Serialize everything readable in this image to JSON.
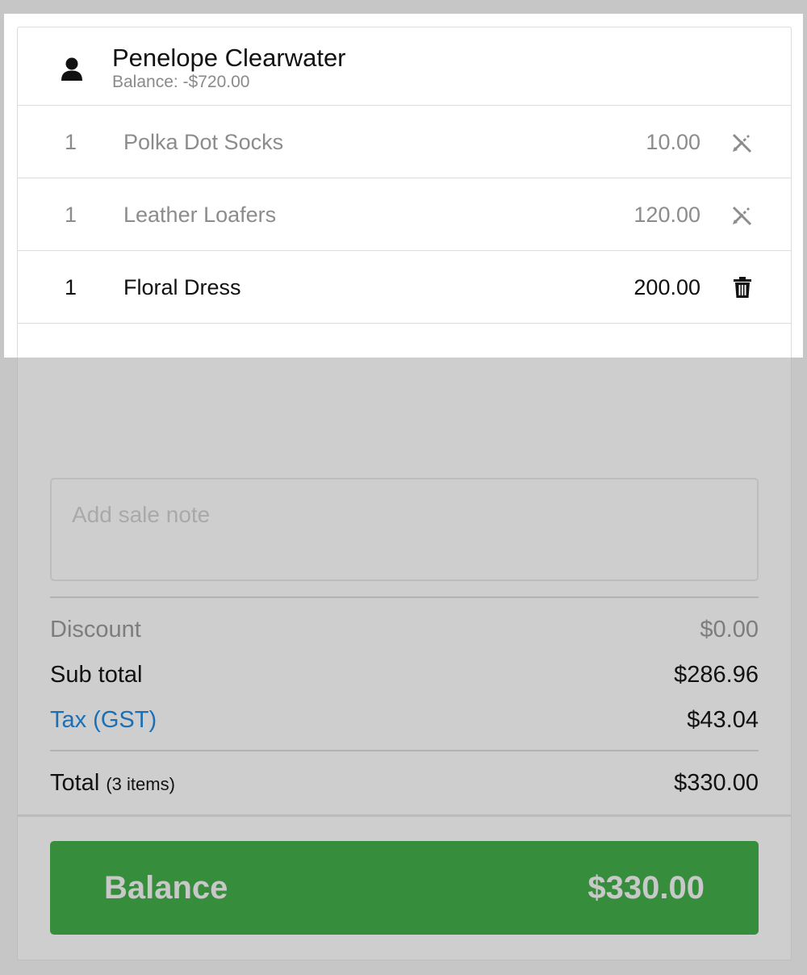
{
  "customer": {
    "name": "Penelope Clearwater",
    "balance_text": "Balance: -$720.00",
    "icon": "user-icon"
  },
  "line_items": [
    {
      "qty": "1",
      "name": "Polka Dot Socks",
      "price": "10.00",
      "action_icon": "pencil-disabled-icon",
      "state": "muted"
    },
    {
      "qty": "1",
      "name": "Leather Loafers",
      "price": "120.00",
      "action_icon": "pencil-disabled-icon",
      "state": "muted"
    },
    {
      "qty": "1",
      "name": "Floral Dress",
      "price": "200.00",
      "action_icon": "trash-icon",
      "state": "active"
    }
  ],
  "note": {
    "placeholder": "Add sale note"
  },
  "summary": {
    "discount_label": "Discount",
    "discount_value": "$0.00",
    "subtotal_label": "Sub total",
    "subtotal_value": "$286.96",
    "tax_label": "Tax (GST)",
    "tax_value": "$43.04",
    "total_label": "Total",
    "total_items": "(3 items)",
    "total_value": "$330.00"
  },
  "pay_button": {
    "label": "Balance",
    "amount": "$330.00",
    "color": "#368e3c"
  },
  "colors": {
    "overlay": "#cecece",
    "link_blue": "#1a6fb5"
  }
}
